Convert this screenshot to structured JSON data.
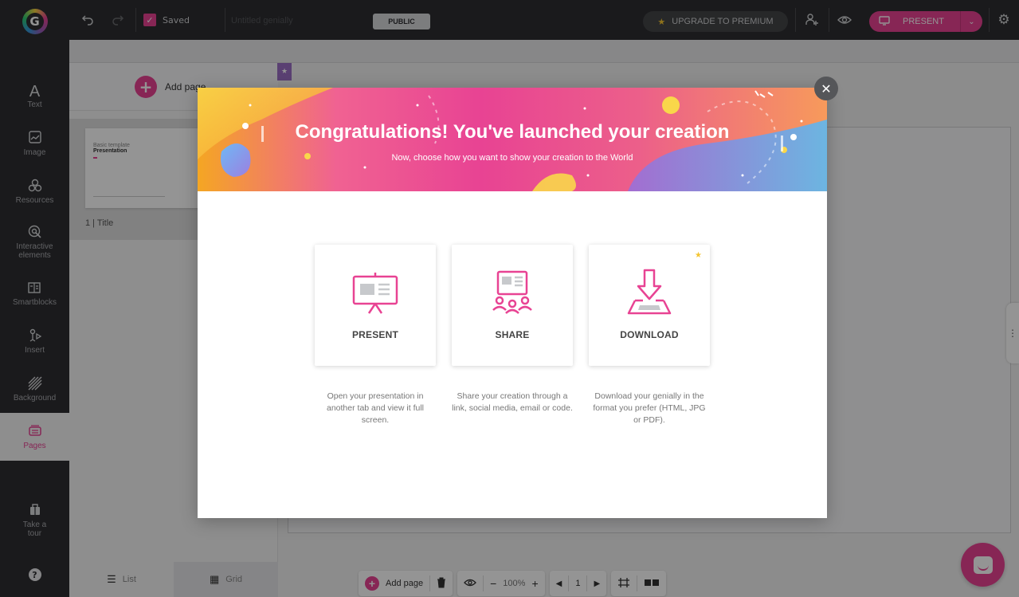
{
  "topbar": {
    "logo_letter": "G",
    "saved_label": "Saved",
    "title_placeholder": "Untitled genially",
    "public_label": "PUBLIC",
    "upgrade_label": "UPGRADE TO PREMIUM",
    "present_label": "PRESENT"
  },
  "sidebar": {
    "items": [
      {
        "label": "Text",
        "icon": "text-icon"
      },
      {
        "label": "Image",
        "icon": "image-icon"
      },
      {
        "label": "Resources",
        "icon": "resources-icon"
      },
      {
        "label": "Interactive elements",
        "icon": "interactive-icon"
      },
      {
        "label": "Smartblocks",
        "icon": "smartblocks-icon"
      },
      {
        "label": "Insert",
        "icon": "insert-icon"
      },
      {
        "label": "Background",
        "icon": "background-icon"
      },
      {
        "label": "Pages",
        "icon": "pages-icon"
      },
      {
        "label": "Take a tour",
        "icon": "tour-icon"
      }
    ],
    "help_label": "?"
  },
  "pages_panel": {
    "add_page_label": "Add page",
    "thumb_subtitle": "Basic template",
    "thumb_title": "Presentation",
    "page_label": "1 | Title",
    "list_label": "List",
    "grid_label": "Grid"
  },
  "bottom_toolbar": {
    "add_page_label": "Add page",
    "zoom": "100%",
    "page_number": "1"
  },
  "modal": {
    "title": "Congratulations! You've launched your creation",
    "subtitle": "Now, choose how you want to show your creation to the World",
    "options": [
      {
        "label": "PRESENT",
        "description": "Open your presentation in another tab and view it full screen."
      },
      {
        "label": "SHARE",
        "description": "Share your creation through a link, social media, email or code."
      },
      {
        "label": "DOWNLOAD",
        "description": "Download your genially in the format you prefer (HTML, JPG or PDF)."
      }
    ]
  },
  "colors": {
    "brand_pink": "#e84393",
    "dark_bg": "#2d2e31",
    "premium_gold": "#f4c531"
  }
}
